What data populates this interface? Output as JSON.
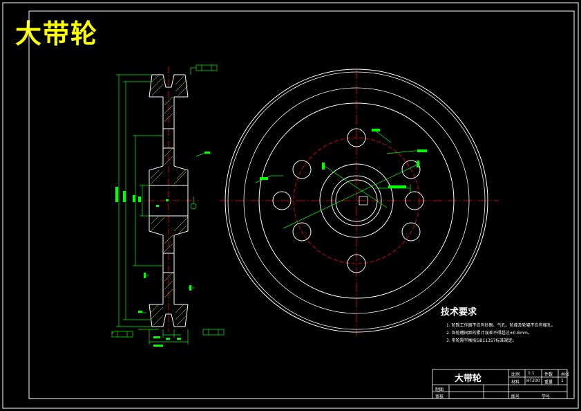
{
  "drawing": {
    "title": "大带轮",
    "tech_requirements": {
      "heading": "技术要求",
      "items": [
        "1. 轮毂工作面不应有砂眼、气孔、轮缘及轮辐不应有缩孔。",
        "2. 各轮槽间距的累计误差不得超过±0.8mm。",
        "3. 带轮需平衡按GB11357标准规定。"
      ]
    },
    "title_block": {
      "part_name": "大带轮",
      "scale_label": "比例",
      "scale_value": "1:1",
      "qty_label": "件数",
      "material_label": "材料",
      "material_value": "HT200",
      "weight_label": "重量",
      "sheet_label": "共张",
      "sheet_value": "1",
      "drawn_label": "制图",
      "checked_label": "审核",
      "drawing_no_label": "图号",
      "school_label": "学号"
    }
  },
  "colors": {
    "background": "#000000",
    "outline": "#ffffff",
    "dimension": "#00ff00",
    "centerline": "#ff0000",
    "hatch": "#ffff00",
    "title": "#ffff00"
  }
}
